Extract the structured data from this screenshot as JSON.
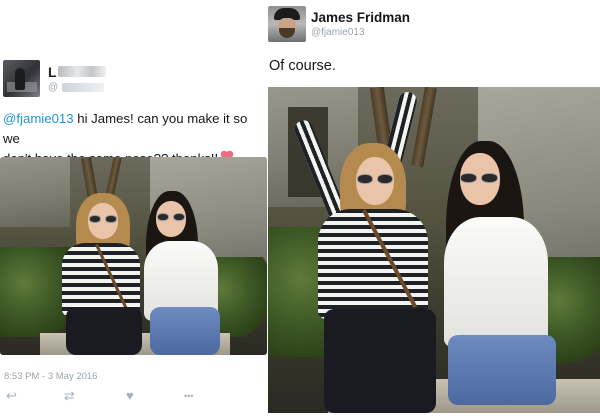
{
  "left_tweet": {
    "display_name": "L",
    "handle": "@",
    "text_mention": "@fjamie013",
    "text_line1": " hi James! can you make it so we",
    "text_line2": "don't have the same pose?? thanks!!",
    "timestamp": "8:53 PM - 3 May 2016",
    "actions": {
      "reply_icon": "reply-icon",
      "retweet_icon": "retweet-icon",
      "like_icon": "heart-icon",
      "more_icon": "more-icon",
      "reply_glyph": "↩",
      "retweet_glyph": "⇄",
      "like_glyph": "♥",
      "more_glyph": "•••"
    }
  },
  "right_tweet": {
    "display_name": "James Fridman",
    "handle": "@fjamie013",
    "text": "Of course."
  },
  "colors": {
    "mention": "#1b95e0",
    "secondary_text": "#9aa4ad",
    "heart_emoji": "#f06b84"
  }
}
